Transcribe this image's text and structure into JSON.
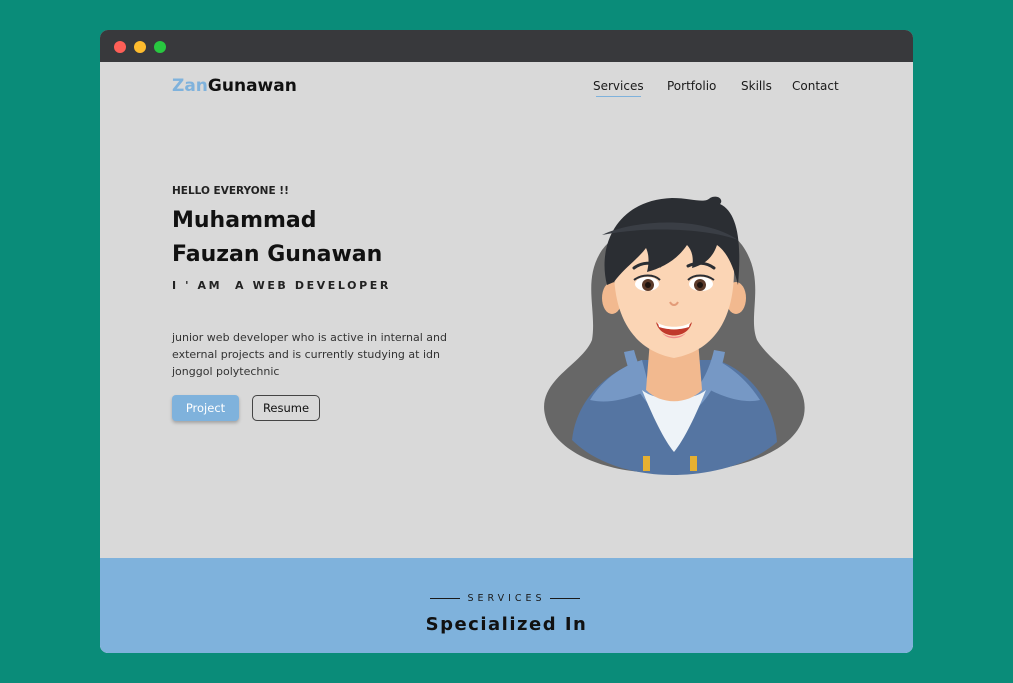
{
  "brand": {
    "part1": "Zan",
    "part2": "Gunawan",
    "accent_color": "#7fb2dc"
  },
  "nav": {
    "items": [
      "Services",
      "Portfolio",
      "Skills",
      "Contact"
    ]
  },
  "hero": {
    "greeting": "HELLO EVERYONE !!",
    "name_line1": "Muhammad",
    "name_line2": "Fauzan Gunawan",
    "role": "I ' AM  A WEB DEVELOPER",
    "description": "junior web developer who is active in internal and external projects and is currently studying at idn jonggol polytechnic",
    "buttons": {
      "project": "Project",
      "resume": "Resume"
    }
  },
  "services": {
    "label": "SERVICES",
    "title": "Specialized In"
  },
  "colors": {
    "background": "#0a8c79",
    "page": "#d9d9d9",
    "band": "#7fb2dc"
  },
  "icons": {
    "avatar": "developer-avatar-illustration"
  }
}
